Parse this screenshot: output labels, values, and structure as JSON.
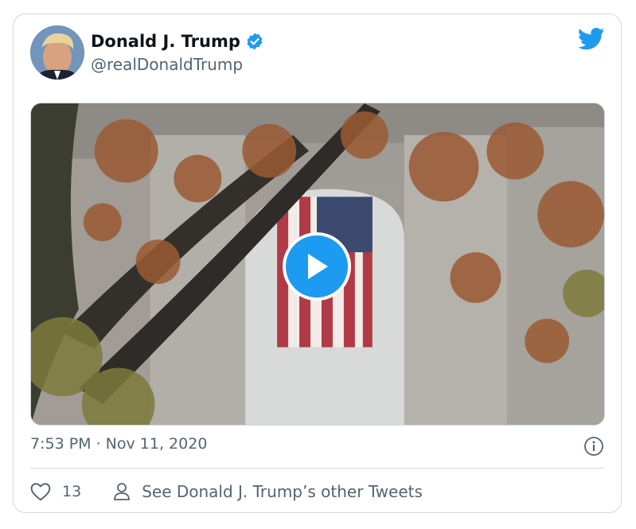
{
  "tweet": {
    "author": {
      "display_name": "Donald J. Trump",
      "handle": "@realDonaldTrump",
      "verified": true,
      "avatar_icon": "avatar-portrait"
    },
    "brand_icon": "twitter-bird-icon",
    "media": {
      "type": "video",
      "play_icon": "play-icon"
    },
    "timestamp": "7:53 PM · Nov 11, 2020",
    "info_icon": "info-icon",
    "actions": {
      "like_icon": "heart-icon",
      "like_count": "13",
      "profile_icon": "person-icon",
      "other_tweets_label": "See Donald J. Trump’s other Tweets"
    }
  },
  "colors": {
    "accent": "#1d9bf0",
    "secondary_text": "#536471",
    "border": "#cfd9de"
  }
}
